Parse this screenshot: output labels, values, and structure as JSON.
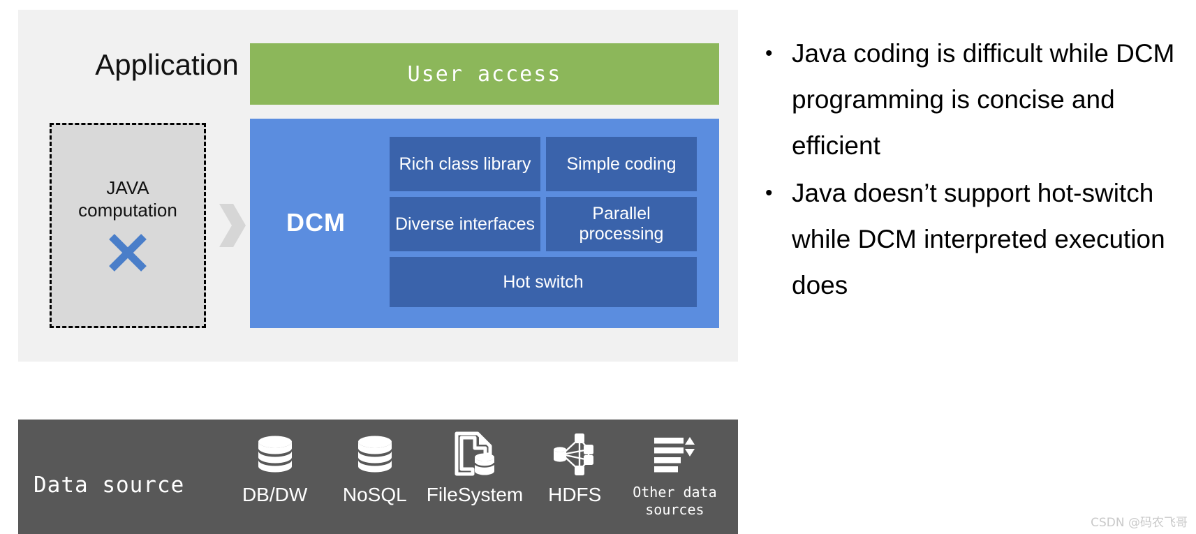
{
  "diagram": {
    "application_label": "Application",
    "user_access": {
      "label": "User access",
      "color": "#8cb75a"
    },
    "java_box": {
      "line1": "JAVA",
      "line2": "computation",
      "mark": "x-mark-icon",
      "mark_color": "#4a7ec9",
      "fill": "#d9d9d9"
    },
    "arrow": "chevron-right-icon",
    "dcm": {
      "title": "DCM",
      "panel_color": "#5b8ddf",
      "cell_color": "#3a63ab",
      "features": [
        [
          "Rich class library",
          "Simple coding"
        ],
        [
          "Diverse interfaces",
          "Parallel processing"
        ]
      ],
      "wide_feature": "Hot switch"
    }
  },
  "data_source": {
    "title": "Data source",
    "bar_color": "#585858",
    "items": [
      {
        "label": "DB/DW",
        "icon": "database-icon",
        "mono": false
      },
      {
        "label": "NoSQL",
        "icon": "database-icon",
        "mono": false
      },
      {
        "label": "FileSystem",
        "icon": "file-database-icon",
        "mono": false
      },
      {
        "label": "HDFS",
        "icon": "distributed-nodes-icon",
        "mono": false
      },
      {
        "label": "Other data sources",
        "icon": "list-sort-icon",
        "mono": true
      }
    ]
  },
  "bullets": [
    {
      "marker": "•",
      "text": "Java coding is difficult while DCM programming is concise and efficient"
    },
    {
      "marker": "•",
      "text": "Java doesn’t support hot-switch while DCM interpreted execution does"
    }
  ],
  "watermark": "CSDN @码农飞哥"
}
